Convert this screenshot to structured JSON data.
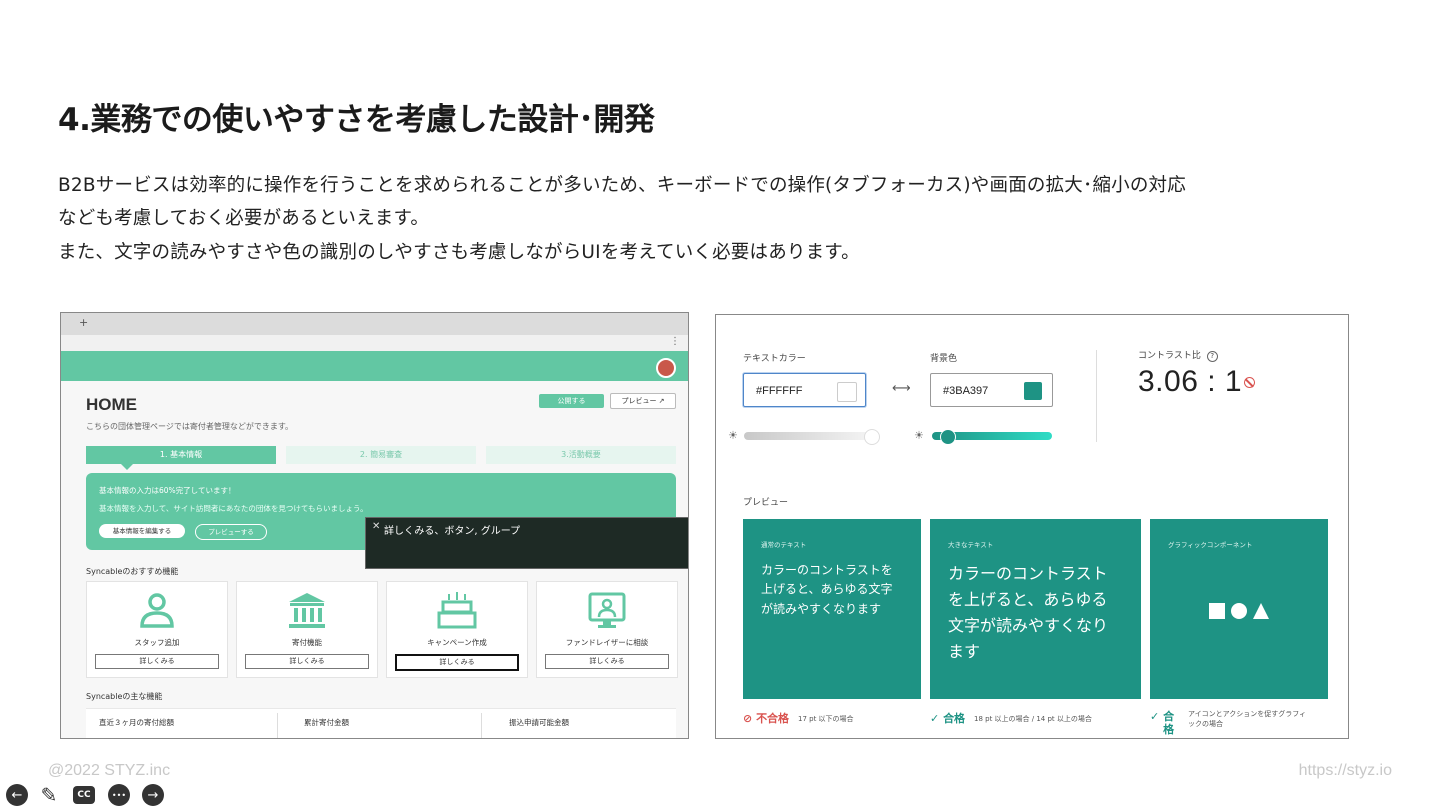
{
  "slide": {
    "title": "4.業務での使いやすさを考慮した設計･開発",
    "body_lines": [
      "B2Bサービスは効率的に操作を行うことを求められることが多いため、キーボードでの操作(タブフォーカス)や画面の拡大･縮小の対応",
      "なども考慮しておく必要があるといえます。",
      "また、文字の読みやすさや色の識別のしやすさも考慮しながらUIを考えていく必要はあります。"
    ],
    "footer_left": "@2022 STYZ.inc",
    "footer_right": "https://styz.io"
  },
  "controls": {
    "prev": "←",
    "pen": "✎",
    "cc": "CC",
    "more": "•••",
    "next": "→"
  },
  "left_screenshot": {
    "tab_plus": "+",
    "menu_dots": "⋮",
    "home_title": "HOME",
    "home_subtitle": "こちらの団体管理ページでは寄付者管理などができます。",
    "publish_button": "公開する",
    "preview_button": "プレビュー ↗",
    "steps": [
      "1. 基本情報",
      "2. 簡易審査",
      "3.活動概要"
    ],
    "banner_title": "基本情報の入力は60%完了しています！",
    "banner_sub": "基本情報を入力して、サイト訪問者にあなたの団体を見つけてもらいましょう。",
    "banner_edit_button": "基本情報を編集する",
    "banner_preview_button": "プレビューする",
    "tooltip_close": "✕",
    "tooltip_text": "詳しくみる、ボタン, グループ",
    "recommended_label": "Syncableのおすすめ機能",
    "features": [
      {
        "name": "スタッフ追加",
        "button": "詳しくみる"
      },
      {
        "name": "寄付機能",
        "button": "詳しくみる"
      },
      {
        "name": "キャンペーン作成",
        "button": "詳しくみる"
      },
      {
        "name": "ファンドレイザーに相談",
        "button": "詳しくみる"
      }
    ],
    "main_label": "Syncableの主な機能",
    "stats": [
      "直近３ヶ月の寄付総額",
      "累計寄付金額",
      "振込申請可能金額"
    ],
    "accent_color": "#62c7a3"
  },
  "right_screenshot": {
    "text_color_label": "テキストカラー",
    "text_color_value": "#FFFFFF",
    "swap_icon": "⟷",
    "bg_color_label": "背景色",
    "bg_color_value": "#3BA397",
    "contrast_label": "コントラスト比",
    "contrast_info_icon": "?",
    "contrast_value": "3.06 : 1",
    "preview_label": "プレビュー",
    "cards": [
      {
        "title": "通常のテキスト",
        "text": "カラーのコントラストを上げると、あらゆる文字が読みやすくなります"
      },
      {
        "title": "大きなテキスト",
        "text": "カラーのコントラストを上げると、あらゆる文字が読みやすくなります"
      },
      {
        "title": "グラフィックコンポーネント",
        "text": ""
      }
    ],
    "verdicts": [
      {
        "label": "不合格",
        "note": "17 pt 以下の場合"
      },
      {
        "label": "合格",
        "note": "18 pt 以上の場合 / 14 pt 以上の場合"
      },
      {
        "label": "合格",
        "note": "アイコンとアクションを促すグラフィックの場合"
      }
    ],
    "card_color": "#1e9384",
    "fail_color": "#d9534f",
    "pass_color": "#1e9384"
  }
}
